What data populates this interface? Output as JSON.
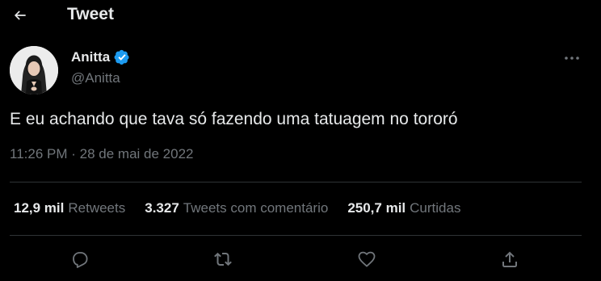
{
  "header": {
    "title": "Tweet",
    "back_icon": "arrow-left-icon"
  },
  "author": {
    "name": "Anitta",
    "handle": "@Anitta",
    "verified_icon": "verified-badge-icon",
    "avatar_icon": "profile-photo"
  },
  "tweet": {
    "text": "E eu achando que tava só fazendo uma tatuagem no tororó",
    "time": "11:26 PM",
    "separator": "·",
    "date": "28 de mai de 2022"
  },
  "stats": [
    {
      "value": "12,9 mil",
      "label": "Retweets"
    },
    {
      "value": "3.327",
      "label": "Tweets com comentário"
    },
    {
      "value": "250,7 mil",
      "label": "Curtidas"
    }
  ],
  "actions": [
    "reply-icon",
    "retweet-icon",
    "like-icon",
    "share-icon"
  ],
  "colors": {
    "background": "#000000",
    "text_primary": "#e7e9ea",
    "text_secondary": "#71767b",
    "divider": "#2f3336",
    "verified": "#1d9bf0"
  }
}
